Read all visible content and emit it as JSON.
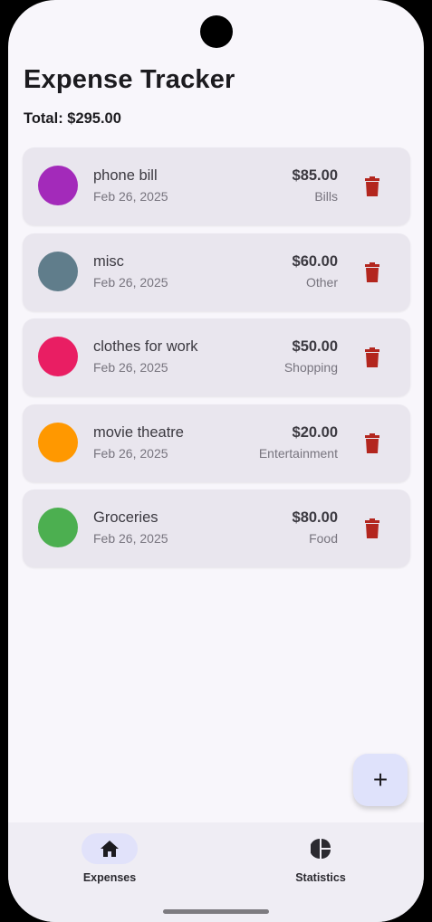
{
  "app": {
    "title": "Expense Tracker",
    "total": "Total: $295.00"
  },
  "expenses": [
    {
      "name": "phone bill",
      "date": "Feb 26, 2025",
      "amount": "$85.00",
      "category": "Bills",
      "color": "#a32aba"
    },
    {
      "name": "misc",
      "date": "Feb 26, 2025",
      "amount": "$60.00",
      "category": "Other",
      "color": "#607d8b"
    },
    {
      "name": "clothes for work",
      "date": "Feb 26, 2025",
      "amount": "$50.00",
      "category": "Shopping",
      "color": "#e91e63"
    },
    {
      "name": "movie theatre",
      "date": "Feb 26, 2025",
      "amount": "$20.00",
      "category": "Entertainment",
      "color": "#ff9800"
    },
    {
      "name": "Groceries",
      "date": "Feb 26, 2025",
      "amount": "$80.00",
      "category": "Food",
      "color": "#4caf50"
    }
  ],
  "fab": {
    "icon": "plus-icon",
    "label": "+"
  },
  "nav": {
    "items": [
      {
        "label": "Expenses",
        "icon": "home-icon",
        "active": true
      },
      {
        "label": "Statistics",
        "icon": "pie-chart-icon",
        "active": false
      }
    ]
  },
  "colors": {
    "delete": "#b3261e",
    "background": "#f8f6fb",
    "card": "#e9e6ee",
    "fab": "#dfe2fb",
    "nav_active": "#e1e2fa"
  }
}
